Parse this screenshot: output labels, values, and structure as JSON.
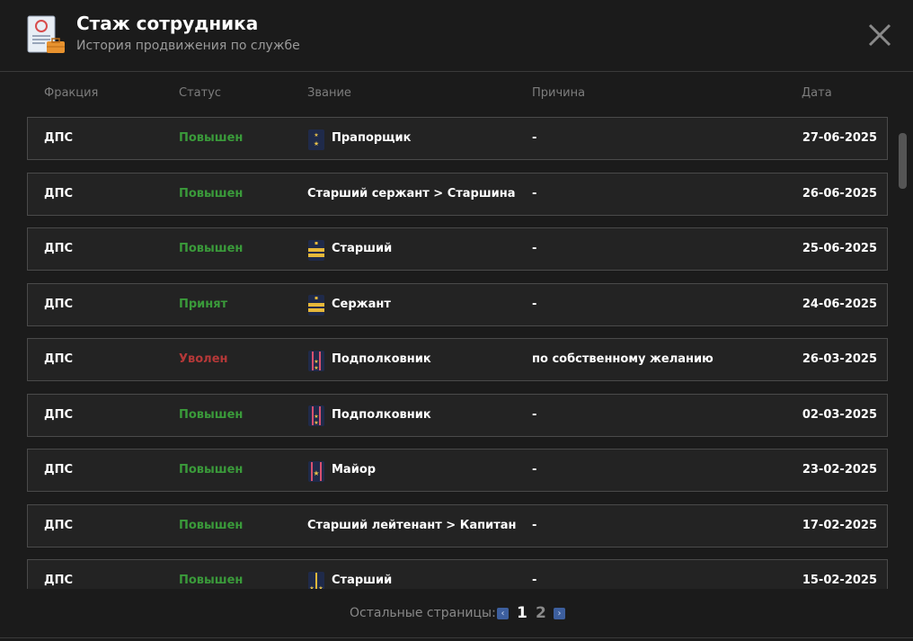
{
  "header": {
    "title": "Стаж сотрудника",
    "subtitle": "История продвижения по службе",
    "icon": "document-briefcase-icon"
  },
  "columns": {
    "faction": "Фракция",
    "status": "Статус",
    "rank": "Звание",
    "reason": "Причина",
    "date": "Дата"
  },
  "rows": [
    {
      "faction": "ДПС",
      "status": "Повышен",
      "status_type": "promoted",
      "rank": "Прапорщик",
      "badge": "warrant-badge",
      "reason": "-",
      "date": "27-06-2025"
    },
    {
      "faction": "ДПС",
      "status": "Повышен",
      "status_type": "promoted",
      "rank": "Старший сержант > Старшина",
      "badge": "",
      "reason": "-",
      "date": "26-06-2025"
    },
    {
      "faction": "ДПС",
      "status": "Повышен",
      "status_type": "promoted",
      "rank": "Старший",
      "badge": "stripes-badge",
      "reason": "-",
      "date": "25-06-2025"
    },
    {
      "faction": "ДПС",
      "status": "Принят",
      "status_type": "hired",
      "rank": "Сержант",
      "badge": "stripes-badge",
      "reason": "-",
      "date": "24-06-2025"
    },
    {
      "faction": "ДПС",
      "status": "Уволен",
      "status_type": "fired",
      "rank": "Подполковник",
      "badge": "two-stripe-badge",
      "reason": "по собственному желанию",
      "date": "26-03-2025"
    },
    {
      "faction": "ДПС",
      "status": "Повышен",
      "status_type": "promoted",
      "rank": "Подполковник",
      "badge": "two-stripe-badge",
      "reason": "-",
      "date": "02-03-2025"
    },
    {
      "faction": "ДПС",
      "status": "Повышен",
      "status_type": "promoted",
      "rank": "Майор",
      "badge": "one-star-badge",
      "reason": "-",
      "date": "23-02-2025"
    },
    {
      "faction": "ДПС",
      "status": "Повышен",
      "status_type": "promoted",
      "rank": "Старший лейтенант > Капитан",
      "badge": "",
      "reason": "-",
      "date": "17-02-2025"
    },
    {
      "faction": "ДПС",
      "status": "Повышен",
      "status_type": "promoted",
      "rank": "Старший",
      "badge": "lieutenant-badge",
      "reason": "-",
      "date": "15-02-2025"
    }
  ],
  "pagination": {
    "label": "Остальные страницы:",
    "pages": [
      "1",
      "2"
    ],
    "current": "1"
  },
  "colors": {
    "promoted": "#3a9a3a",
    "fired": "#b53838",
    "background": "#1b1b1b"
  }
}
